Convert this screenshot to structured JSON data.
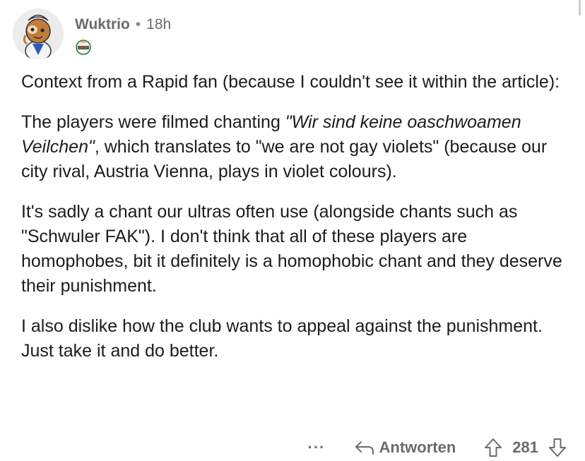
{
  "comment": {
    "author": "Wuktrio",
    "separator": "•",
    "age": "18h",
    "avatar_icon": "snoo-avatar-icon",
    "flair_icon": "rapid-crest-icon",
    "paragraphs": [
      {
        "text": "Context from a Rapid fan (because I couldn't see it within the article):"
      },
      {
        "before": "The players were filmed chanting ",
        "italic": "\"Wir sind keine oaschwoamen Veilchen\"",
        "after": ", which translates to \"we are not gay violets\" (because our city rival, Austria Vienna, plays in violet colours)."
      },
      {
        "text": "It's sadly a chant our ultras often use (alongside chants such as \"Schwuler FAK\"). I don't think that all of these players are homophobes, bit it definitely is a homophobic chant and they deserve their punishment."
      },
      {
        "text": "I also dislike how the club wants to appeal against the punishment. Just take it and do better."
      }
    ]
  },
  "actions": {
    "more_label": "···",
    "reply_label": "Antworten",
    "reply_icon": "reply-arrow-icon",
    "upvote_icon": "upvote-arrow-icon",
    "downvote_icon": "downvote-arrow-icon",
    "score": "281"
  },
  "colors": {
    "text": "#1c1c1c",
    "meta": "#6b6b6b",
    "background": "#ffffff"
  }
}
